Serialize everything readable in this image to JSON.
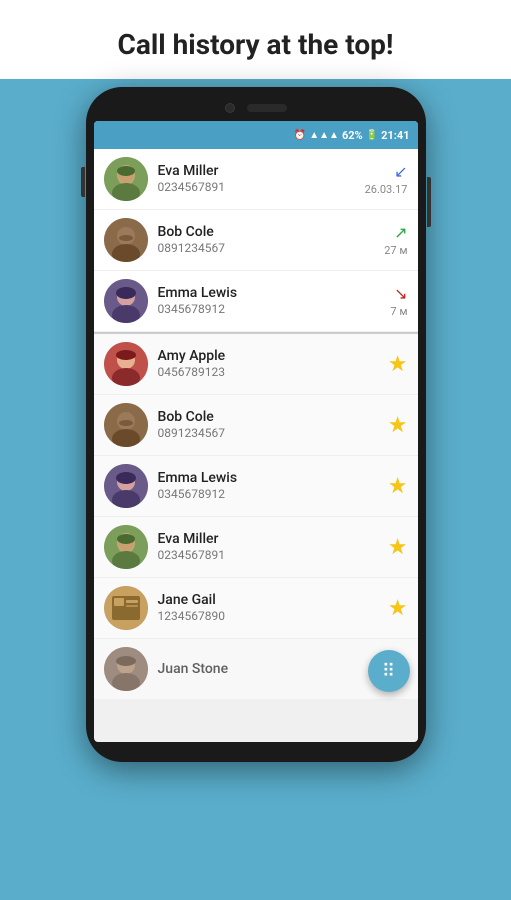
{
  "header": {
    "title": "Call history at the top!"
  },
  "statusBar": {
    "alarm": "⏰",
    "signal": "📶",
    "battery": "62%",
    "time": "21:41"
  },
  "contacts": {
    "recent": [
      {
        "id": "eva-miller-recent",
        "name": "Eva Miller",
        "number": "0234567891",
        "callType": "incoming",
        "callLabel": "↙",
        "callTime": "26.03.17",
        "avatarType": "eva"
      },
      {
        "id": "bob-cole-recent",
        "name": "Bob Cole",
        "number": "0891234567",
        "callType": "outgoing",
        "callLabel": "↗",
        "callTime": "27 м",
        "avatarType": "bob"
      },
      {
        "id": "emma-lewis-recent",
        "name": "Emma Lewis",
        "number": "0345678912",
        "callType": "missed",
        "callLabel": "↘",
        "callTime": "7 м",
        "avatarType": "emma"
      }
    ],
    "favorites": [
      {
        "id": "amy-apple-fav",
        "name": "Amy Apple",
        "number": "0456789123",
        "avatarType": "amy"
      },
      {
        "id": "bob-cole-fav",
        "name": "Bob Cole",
        "number": "0891234567",
        "avatarType": "bob"
      },
      {
        "id": "emma-lewis-fav",
        "name": "Emma Lewis",
        "number": "0345678912",
        "avatarType": "emma"
      },
      {
        "id": "eva-miller-fav",
        "name": "Eva Miller",
        "number": "0234567891",
        "avatarType": "eva"
      },
      {
        "id": "jane-gail-fav",
        "name": "Jane Gail",
        "number": "1234567890",
        "avatarType": "jane"
      },
      {
        "id": "juan-stone-fav",
        "name": "Juan Stone",
        "number": "",
        "avatarType": "juan"
      }
    ]
  },
  "fab": {
    "icon": "⠿",
    "label": "dialpad"
  }
}
